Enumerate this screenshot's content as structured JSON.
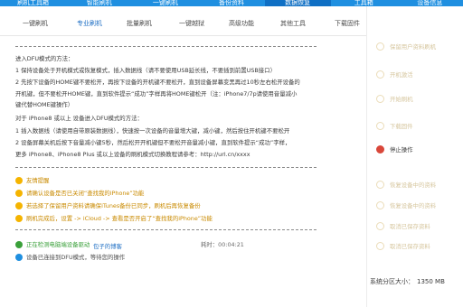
{
  "nav": {
    "items": [
      "刷机工具箱",
      "智能刷机",
      "一键刷机",
      "备份资料",
      "数据恢复",
      "工具箱",
      "设备信息"
    ],
    "active_index": 4
  },
  "subtabs": {
    "items": [
      "一键刷机",
      "专业刷机",
      "批量刷机",
      "一键越狱",
      "高级功能",
      "其他工具",
      "下载固件"
    ],
    "active_index": 1
  },
  "instructions": {
    "heading": "进入DFU模式的方法：",
    "lines": [
      "1 保持设备处于开机模式或恢复模式，插入数据线（请不要使用USB延长线，不要插到前置USB接口）",
      "2 先按下设备的HOME键不要松开，再按下设备的开机键不要松开，直到设备屏幕变黑再过10秒左右松开设备的",
      "开机键，但不要松开HOME键，直到软件提示“成功”字样再将HOME键松开（注：iPhone7/7p请使用音量减小",
      "键代替HOME键操作）",
      "对于 iPhone8 或以上 设备进入DFU模式的方法：",
      "1 插入数据线（请使用自带原装数据线），快速按一次设备的音量增大键，减小键，然后按住开机键不要松开",
      "2 设备屏幕关机后按下音量减小键5秒，然后松开开机键但不要松开音量减小键，直到软件提示“成功”字样，",
      "更多 iPhone8、iPhone8 Plus 或以上设备的刷机模式切换教程请参考：http://url.cn/xxxx"
    ]
  },
  "tips": {
    "label": "友情提醒",
    "items": [
      "请确认设备是否已关闭“查找我的iPhone”功能",
      "若选择了保留用户资料请确保iTunes备份已同步，刷机后再恢复备份",
      "刷机完成后，设置 -> iCloud -> 查看是否开启了“查找我的iPhone”功能"
    ]
  },
  "status": {
    "connected": "正在检测电脑端设备驱动",
    "timer_label": "耗时：",
    "timer_value": "00:04:21",
    "mode": "设备已连接到DFU模式，等待您的操作"
  },
  "footer": {
    "link": "包子的博客"
  },
  "sidebar": {
    "items": [
      {
        "label": "保留用户资料刷机",
        "kind": "normal"
      },
      {
        "label": "开机激活",
        "kind": "normal"
      },
      {
        "label": "开始刷机",
        "kind": "normal"
      },
      {
        "label": "下载固件",
        "kind": "normal"
      },
      {
        "label": "停止操作",
        "kind": "stop"
      },
      {
        "label": "恢复设备中的资料",
        "kind": "normal"
      },
      {
        "label": "恢复设备中的资料",
        "kind": "normal"
      },
      {
        "label": "取消已保存资料",
        "kind": "normal"
      },
      {
        "label": "取消已保存资料",
        "kind": "normal"
      }
    ],
    "size_label": "系统分区大小：",
    "size_value": "1350 MB"
  },
  "colors": {
    "nav_bg": "#1f8fe0",
    "tip_dot": "#f5b400",
    "tip_text": "#c98a00",
    "ok_green": "#3aa03a",
    "info_blue": "#1f8fe0",
    "stop_red": "#d9473a",
    "link_blue": "#1f6fc4"
  }
}
